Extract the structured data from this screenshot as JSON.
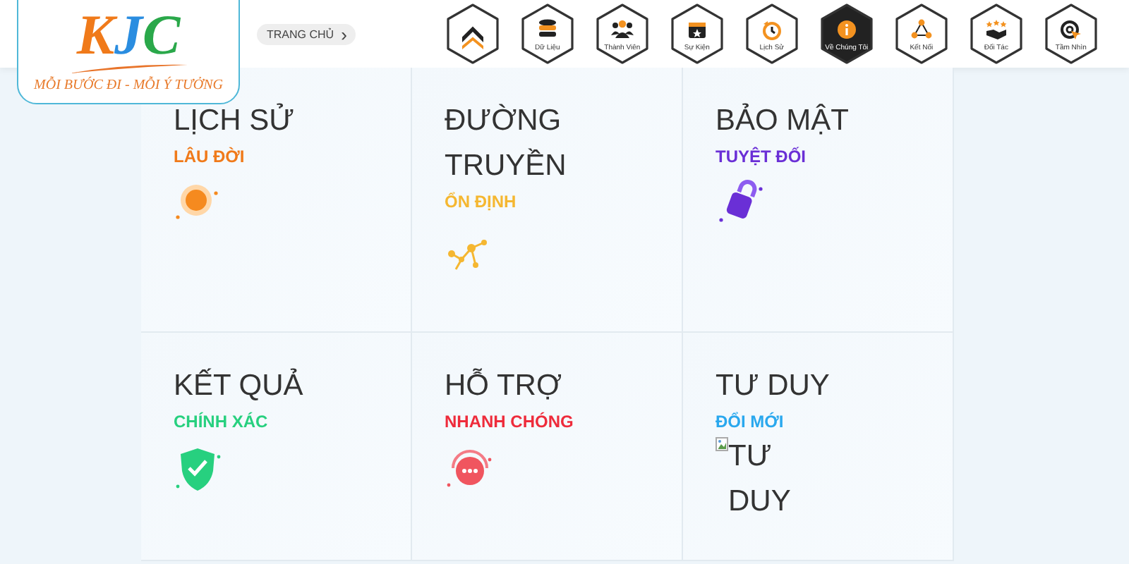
{
  "logo": {
    "brand_letters": [
      {
        "text": "K",
        "color": "#f07a1a"
      },
      {
        "text": "J",
        "color": "#2a8de0"
      },
      {
        "text": "C",
        "color": "#2aa84a"
      }
    ],
    "slogan": "MỖI BƯỚC ĐI - MỖI Ý TƯỞNG"
  },
  "breadcrumb": {
    "label": "TRANG CHỦ",
    "arrow": "›"
  },
  "nav": [
    {
      "selected": false
    },
    {
      "label": "Dữ Liệu",
      "selected": false
    },
    {
      "label": "Thành Viên",
      "selected": false
    },
    {
      "label": "Sự Kiện",
      "selected": false
    },
    {
      "label": "Lịch Sử",
      "selected": false
    },
    {
      "label": "Về Chúng Tôi",
      "selected": true
    },
    {
      "label": "Kết Nối",
      "selected": false
    },
    {
      "label": "Đối Tác",
      "selected": false
    },
    {
      "label": "Tầm Nhìn",
      "selected": false
    }
  ],
  "features": [
    {
      "kind": "icon",
      "title": "LỊCH SỬ",
      "subtitle": "LÂU ĐỜI",
      "color": "#f07a1a"
    },
    {
      "kind": "icon",
      "title": "ĐƯỜNG TRUYỀN",
      "subtitle": "ỔN ĐỊNH",
      "color": "#f5b731"
    },
    {
      "kind": "icon",
      "title": "BẢO MẬT",
      "subtitle": "TUYỆT ĐỐI",
      "color": "#6a2fd6"
    },
    {
      "kind": "icon",
      "title": "KẾT QUẢ",
      "subtitle": "CHÍNH XÁC",
      "color": "#27d07f"
    },
    {
      "kind": "icon",
      "title": "HỖ TRỢ",
      "subtitle": "NHANH CHÓNG",
      "color": "#ee2b3b"
    },
    {
      "kind": "broken-image",
      "title": "TƯ DUY",
      "subtitle": "ĐỔI MỚI",
      "color": "#2aa8ee",
      "image_alt": "TƯ DUY"
    }
  ]
}
